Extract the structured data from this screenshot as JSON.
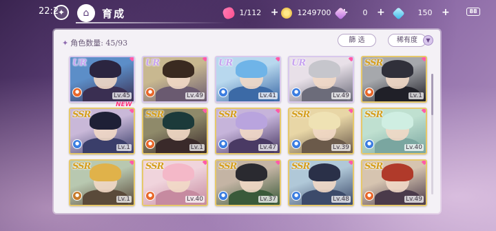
{
  "header": {
    "clock": "22:2",
    "title": "育成",
    "resources": {
      "candy": "1/112",
      "coin": "1249700",
      "gem_pink": "0",
      "gem_blue": "150"
    },
    "battery": "88"
  },
  "panel": {
    "count_label": "角色数量: 45/93",
    "filter_button": "篩 选",
    "rarity_button": "稀有度"
  },
  "cards": [
    {
      "rarity": "UR",
      "level": "Lv.45",
      "element_color": "#e8672a",
      "palette": [
        "#5c8ec8",
        "#2b2540",
        "#3a2f52"
      ]
    },
    {
      "rarity": "UR",
      "level": "Lv.49",
      "element_color": "#e8672a",
      "palette": [
        "#c8b890",
        "#3a2a20",
        "#6a5a70"
      ]
    },
    {
      "rarity": "UR",
      "level": "Lv.41",
      "element_color": "#3b7de0",
      "palette": [
        "#b8d8ee",
        "#6fb4e8",
        "#3c6aa6"
      ]
    },
    {
      "rarity": "UR",
      "level": "Lv.49",
      "element_color": "#3b7de0",
      "palette": [
        "#e8e0e8",
        "#c6c6cc",
        "#6c6c7a"
      ]
    },
    {
      "rarity": "SSR",
      "level": "Lv.1",
      "element_color": "#e8672a",
      "palette": [
        "#a6a8ac",
        "#30303a",
        "#202028"
      ]
    },
    {
      "rarity": "SSR",
      "level": "Lv.1",
      "element_color": "#3b7de0",
      "palette": [
        "#c9b8d8",
        "#1e2036",
        "#3a3e6a"
      ],
      "new": "NEW"
    },
    {
      "rarity": "SSR",
      "level": "Lv.1",
      "element_color": "#e8672a",
      "palette": [
        "#8f8a6a",
        "#1c3a3a",
        "#3a2a2a"
      ]
    },
    {
      "rarity": "SSR",
      "level": "Lv.47",
      "element_color": "#3b7de0",
      "palette": [
        "#c6b4da",
        "#b9a4de",
        "#4a3a64"
      ]
    },
    {
      "rarity": "SSR",
      "level": "Lv.39",
      "element_color": "#3b7de0",
      "palette": [
        "#e8d6a6",
        "#efe2b4",
        "#6b5a4a"
      ]
    },
    {
      "rarity": "SSR",
      "level": "Lv.40",
      "element_color": "#3b7de0",
      "palette": [
        "#bfe0d0",
        "#cfeee2",
        "#7aa6a0"
      ]
    },
    {
      "rarity": "SSR",
      "level": "Lv.1",
      "element_color": "#c77a2a",
      "palette": [
        "#b8c8b0",
        "#e0b24a",
        "#5a4a3a"
      ]
    },
    {
      "rarity": "SSR",
      "level": "Lv.40",
      "element_color": "#e8672a",
      "palette": [
        "#f0d4dc",
        "#f4b8c8",
        "#c68aa0"
      ]
    },
    {
      "rarity": "SSR",
      "level": "Lv.37",
      "element_color": "#3b7de0",
      "palette": [
        "#c4b4a4",
        "#2a2a30",
        "#3a5a3a"
      ]
    },
    {
      "rarity": "SSR",
      "level": "Lv.48",
      "element_color": "#3b7de0",
      "palette": [
        "#b0c8d8",
        "#2a3048",
        "#3c4a6a"
      ]
    },
    {
      "rarity": "SSR",
      "level": "Lv.49",
      "element_color": "#e8672a",
      "palette": [
        "#d6c4b0",
        "#b03a2a",
        "#4a3a4a"
      ]
    }
  ]
}
